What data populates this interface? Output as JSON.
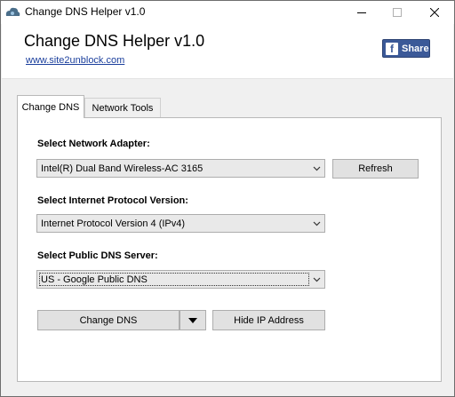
{
  "window": {
    "title": "Change DNS Helper v1.0"
  },
  "header": {
    "app_title": "Change DNS Helper v1.0",
    "website_link": "www.site2unblock.com",
    "share_label": "Share"
  },
  "tabs": [
    {
      "label": "Change DNS",
      "active": true
    },
    {
      "label": "Network Tools",
      "active": false
    }
  ],
  "form": {
    "adapter": {
      "label": "Select Network Adapter:",
      "selected": "Intel(R) Dual Band Wireless-AC 3165",
      "refresh_label": "Refresh"
    },
    "protocol": {
      "label": "Select Internet Protocol Version:",
      "selected": "Internet Protocol Version 4 (IPv4)"
    },
    "dns_server": {
      "label": "Select Public DNS Server:",
      "selected": "US - Google Public DNS"
    }
  },
  "actions": {
    "change_dns_label": "Change DNS",
    "hide_ip_label": "Hide IP Address"
  },
  "colors": {
    "facebook_blue": "#3b5998",
    "link_blue": "#1a3e9c",
    "window_bg": "#f0f0f0"
  }
}
